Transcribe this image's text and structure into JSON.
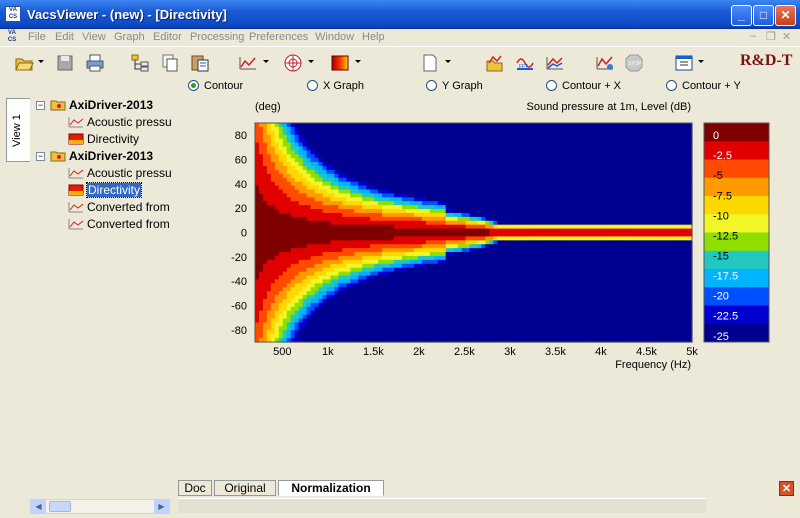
{
  "window": {
    "title": "VacsViewer - (new) - [Directivity]",
    "app_icon_text": "VA CS"
  },
  "menu": [
    "File",
    "Edit",
    "View",
    "Graph",
    "Editor",
    "Processing",
    "Preferences",
    "Window",
    "Help"
  ],
  "toolbar": {
    "brand": "R&D-T"
  },
  "view_options": [
    {
      "label": "Contour",
      "selected": true
    },
    {
      "label": "X Graph",
      "selected": false
    },
    {
      "label": "Y Graph",
      "selected": false
    },
    {
      "label": "Contour + X",
      "selected": false
    },
    {
      "label": "Contour + Y",
      "selected": false
    }
  ],
  "side_tab": "View 1",
  "tree": [
    {
      "label": "AxiDriver-2013",
      "kind": "group",
      "expanded": true
    },
    {
      "label": "Acoustic pressure",
      "kind": "curve"
    },
    {
      "label": "Directivity",
      "kind": "map"
    },
    {
      "label": "AxiDriver-2013",
      "kind": "group",
      "expanded": true
    },
    {
      "label": "Acoustic pressure",
      "kind": "curve"
    },
    {
      "label": "Directivity",
      "kind": "map",
      "selected": true
    },
    {
      "label": "Converted from",
      "kind": "curve"
    },
    {
      "label": "Converted from",
      "kind": "curve"
    }
  ],
  "chart_data": {
    "type": "heatmap",
    "title": "Sound pressure at 1m, Level  (dB)",
    "ylabel": "(deg)",
    "xlabel": "Frequency  (Hz)",
    "x_ticks": [
      "500",
      "1k",
      "1.5k",
      "2k",
      "2.5k",
      "3k",
      "3.5k",
      "4k",
      "4.5k",
      "5k"
    ],
    "y_ticks": [
      "80",
      "60",
      "40",
      "20",
      "0",
      "-20",
      "-40",
      "-60",
      "-80"
    ],
    "xlim": [
      200,
      5000
    ],
    "ylim": [
      -90,
      90
    ],
    "colorbar": {
      "levels": [
        "0",
        "-2.5",
        "-5",
        "-7.5",
        "-10",
        "-12.5",
        "-15",
        "-17.5",
        "-20",
        "-22.5",
        "-25"
      ],
      "colors": [
        "#800000",
        "#e00000",
        "#ff4a00",
        "#ff9a00",
        "#ffd800",
        "#f2f526",
        "#8fe000",
        "#20c8c0",
        "#00b4ff",
        "#0050ff",
        "#0000d0",
        "#000090"
      ]
    }
  },
  "bottom_tabs": [
    {
      "label": "Doc",
      "active": false
    },
    {
      "label": "Original",
      "active": false
    },
    {
      "label": "Normalization",
      "active": true
    }
  ]
}
